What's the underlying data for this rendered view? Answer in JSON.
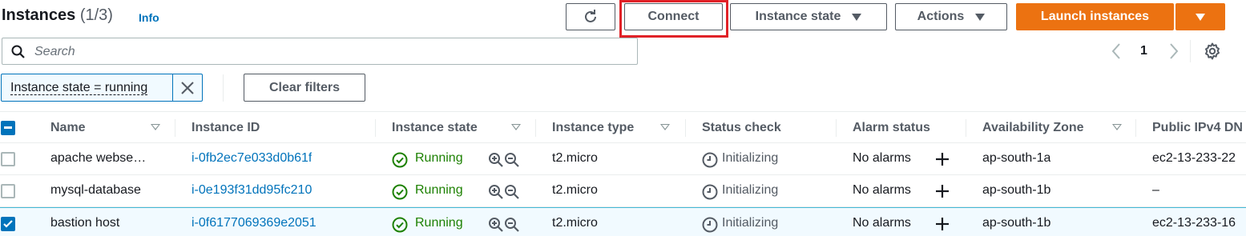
{
  "header": {
    "title": "Instances",
    "count": "(1/3)",
    "info": "Info",
    "connect_label": "Connect",
    "instance_state_label": "Instance state",
    "actions_label": "Actions",
    "launch_label": "Launch instances"
  },
  "search": {
    "placeholder": "Search",
    "value": ""
  },
  "pagination": {
    "page": "1"
  },
  "filter": {
    "token": "Instance state = running",
    "clear_label": "Clear filters"
  },
  "table": {
    "columns": [
      "Name",
      "Instance ID",
      "Instance state",
      "Instance type",
      "Status check",
      "Alarm status",
      "Availability Zone",
      "Public IPv4 DN"
    ],
    "rows": [
      {
        "name": "apache webse…",
        "id": "i-0fb2ec7e033d0b61f",
        "state": "Running",
        "type": "t2.micro",
        "status": "Initializing",
        "alarm": "No alarms",
        "zone": "ap-south-1a",
        "ipv4": "ec2-13-233-22",
        "selected": false
      },
      {
        "name": "mysql-database",
        "id": "i-0e193f31dd95fc210",
        "state": "Running",
        "type": "t2.micro",
        "status": "Initializing",
        "alarm": "No alarms",
        "zone": "ap-south-1b",
        "ipv4": "–",
        "selected": false
      },
      {
        "name": "bastion host",
        "id": "i-0f6177069369e2051",
        "state": "Running",
        "type": "t2.micro",
        "status": "Initializing",
        "alarm": "No alarms",
        "zone": "ap-south-1b",
        "ipv4": "ec2-13-233-16",
        "selected": true
      }
    ]
  },
  "colors": {
    "accent": "#0073bb",
    "primary_button": "#ec7211",
    "running": "#1d8102",
    "highlight": "#e02127"
  },
  "icons": [
    "refresh-icon",
    "caret-down-icon",
    "search-icon",
    "chevron-left-icon",
    "chevron-right-icon",
    "settings-gear-icon",
    "close-icon",
    "check-circle-icon",
    "zoom-in-icon",
    "zoom-out-icon",
    "clock-icon",
    "plus-icon"
  ]
}
